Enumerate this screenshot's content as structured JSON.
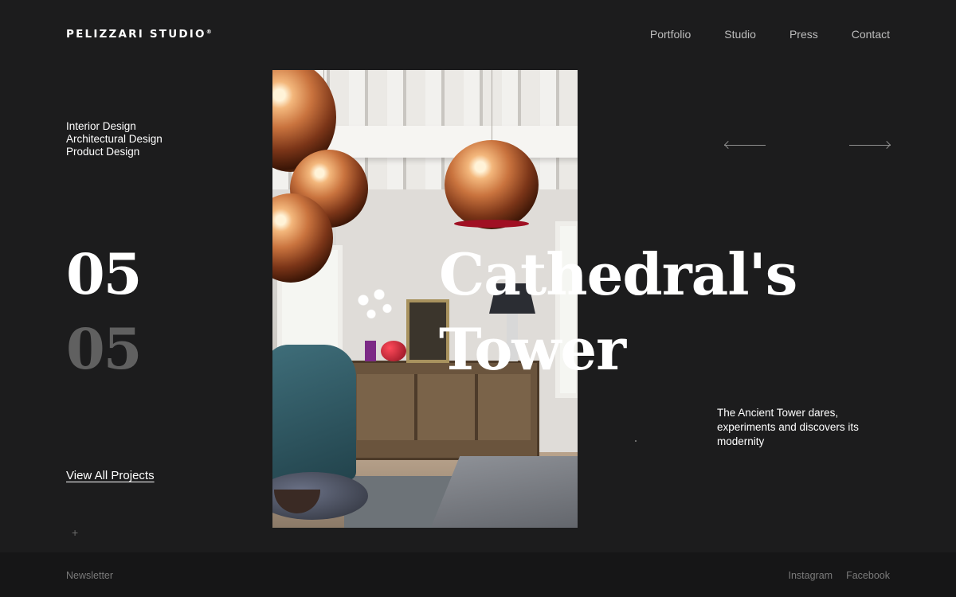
{
  "header": {
    "logo": "PELIZZARI STUDIO",
    "logo_mark": "®",
    "nav": [
      {
        "label": "Portfolio"
      },
      {
        "label": "Studio"
      },
      {
        "label": "Press"
      },
      {
        "label": "Contact"
      }
    ]
  },
  "services": [
    "Interior Design",
    "Architectural Design",
    "Product Design"
  ],
  "slider": {
    "current": "05",
    "total": "05",
    "title_line1": "Cathedral's",
    "title_line2": "Tower",
    "description": "The Ancient Tower dares, experiments and discovers its modernity",
    "view_all": "View All Projects",
    "plus": "+"
  },
  "footer": {
    "newsletter": "Newsletter",
    "social": [
      {
        "label": "Instagram"
      },
      {
        "label": "Facebook"
      }
    ]
  }
}
